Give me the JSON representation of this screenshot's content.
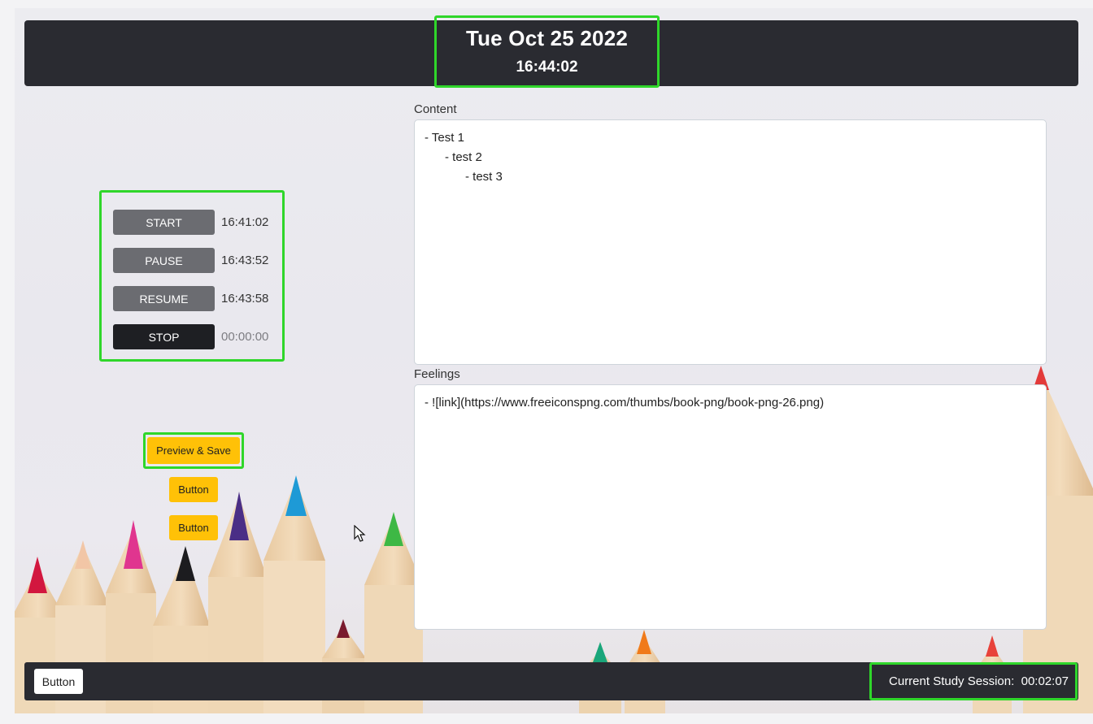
{
  "header": {
    "date": "Tue Oct 25 2022",
    "time": "16:44:02"
  },
  "timer": [
    {
      "label": "START",
      "value": "16:41:02"
    },
    {
      "label": "PAUSE",
      "value": "16:43:52"
    },
    {
      "label": "RESUME",
      "value": "16:43:58"
    },
    {
      "label": "STOP",
      "value": "00:00:00"
    }
  ],
  "actions": {
    "preview_save": "Preview & Save",
    "button_1": "Button",
    "button_2": "Button"
  },
  "content": {
    "label": "Content",
    "value": "- Test 1\n      - test 2\n            - test 3"
  },
  "feelings": {
    "label": "Feelings",
    "value": "- ![link](https://www.freeiconspng.com/thumbs/book-png/book-png-26.png)"
  },
  "footer": {
    "button": "Button",
    "session_label": "Current Study Session:",
    "session_value": "00:02:07"
  },
  "colors": {
    "bar": "#2a2b31",
    "highlight": "#2fd62a",
    "warning": "#ffc107",
    "secondary": "#6b6c71",
    "dark": "#1e1f23"
  }
}
